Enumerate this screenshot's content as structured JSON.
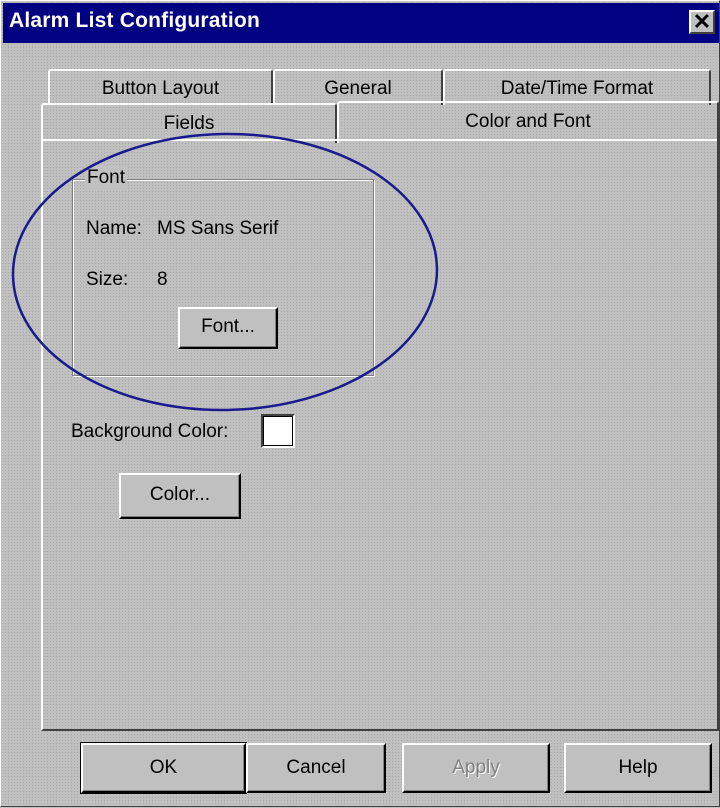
{
  "window": {
    "title": "Alarm List Configuration",
    "close_glyph": "✕"
  },
  "tabs": {
    "row_back": [
      {
        "label": "Button Layout"
      },
      {
        "label": "General"
      },
      {
        "label": "Date/Time Format"
      }
    ],
    "row_front": [
      {
        "label": "Fields"
      },
      {
        "label": "Color and Font",
        "active": true
      }
    ]
  },
  "font_group": {
    "legend": "Font",
    "name_label": "Name:",
    "name_value": "MS Sans Serif",
    "size_label": "Size:",
    "size_value": "8",
    "font_button": "Font..."
  },
  "background": {
    "label": "Background Color:",
    "swatch_color": "#ffffff",
    "color_button": "Color..."
  },
  "footer": {
    "ok": "OK",
    "cancel": "Cancel",
    "apply": "Apply",
    "help": "Help"
  },
  "annotation": {
    "color": "#1a1a8c",
    "shape": "ellipse"
  },
  "colors": {
    "titlebar": "#000080",
    "face": "#c0c0c0"
  }
}
